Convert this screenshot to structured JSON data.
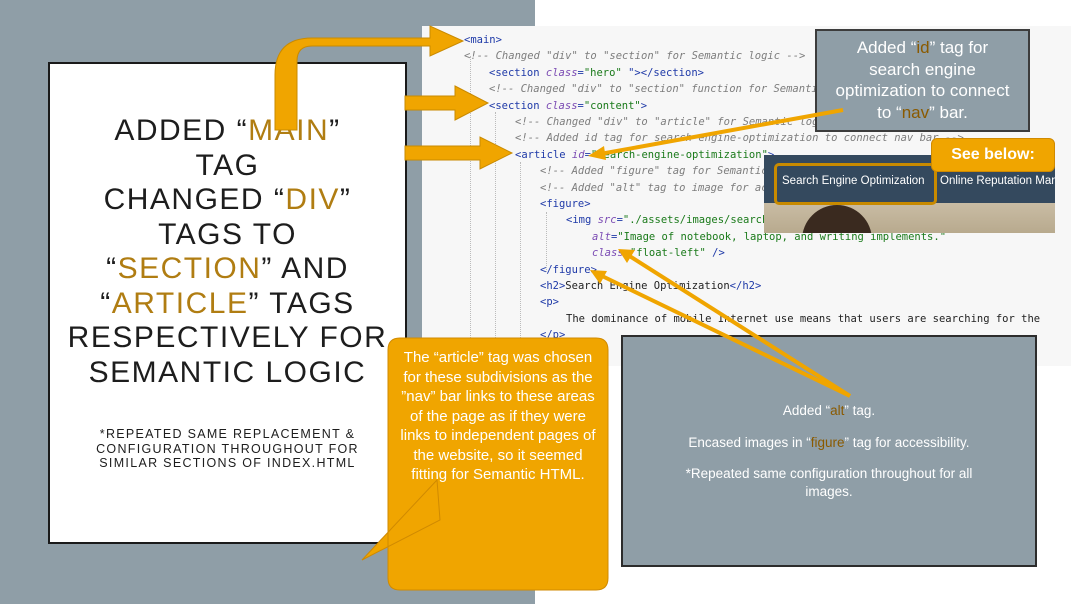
{
  "left_panel": {
    "title_lines": [
      {
        "pre": "ADDED “",
        "hl": "MAIN",
        "post": "”"
      },
      {
        "pre": "TAG",
        "hl": "",
        "post": ""
      },
      {
        "pre": "CHANGED “",
        "hl": "DIV",
        "post": "”"
      },
      {
        "pre": "TAGS TO",
        "hl": "",
        "post": ""
      },
      {
        "pre": "“",
        "hl": "SECTION",
        "post": "” AND"
      },
      {
        "pre": "“",
        "hl": "ARTICLE",
        "post": "” TAGS"
      },
      {
        "pre": "RESPECTIVELY FOR",
        "hl": "",
        "post": ""
      },
      {
        "pre": "SEMANTIC LOGIC",
        "hl": "",
        "post": ""
      }
    ],
    "note": "*REPEATED SAME REPLACEMENT & CONFIGURATION THROUGHOUT FOR SIMILAR SECTIONS OF INDEX.HTML"
  },
  "code": {
    "lines": [
      [
        {
          "c": "tag",
          "t": "<main>"
        }
      ],
      [
        {
          "c": "cmt",
          "t": "<!-- Changed \"div\" to \"section\" for Semantic logic --> "
        }
      ],
      [
        {
          "c": "tag",
          "t": "<section "
        },
        {
          "c": "attr",
          "t": "class"
        },
        {
          "c": "tag",
          "t": "="
        },
        {
          "c": "str",
          "t": "\"hero\""
        },
        {
          "c": "tag",
          "t": " \"></section>"
        }
      ],
      [
        {
          "c": "cmt",
          "t": "<!-- Changed \"div\" to \"section\" function for Semantic logic -->"
        }
      ],
      [
        {
          "c": "tag",
          "t": "<section "
        },
        {
          "c": "attr",
          "t": "class"
        },
        {
          "c": "tag",
          "t": "="
        },
        {
          "c": "str",
          "t": "\"content\""
        },
        {
          "c": "tag",
          "t": ">"
        }
      ],
      [
        {
          "c": "cmt",
          "t": "<!-- Changed \"div\" to \"article\" for Semantic logic -->"
        }
      ],
      [
        {
          "c": "cmt",
          "t": "<!-- Added id tag for search-engine-optimization to connect nav bar -->"
        }
      ],
      [
        {
          "c": "tag",
          "t": "<article "
        },
        {
          "c": "attr",
          "t": "id"
        },
        {
          "c": "tag",
          "t": "="
        },
        {
          "c": "str",
          "t": "\"search-engine-optimization\""
        },
        {
          "c": "tag",
          "t": ">"
        }
      ],
      [
        {
          "c": "cmt",
          "t": "<!-- Added \"figure\" tag for Semantic logic -->"
        }
      ],
      [
        {
          "c": "cmt",
          "t": "<!-- Added \"alt\" tag to image for accessibility -->"
        }
      ],
      [
        {
          "c": "tag",
          "t": "<figure>"
        }
      ],
      [
        {
          "c": "tag",
          "t": "<img "
        },
        {
          "c": "attr",
          "t": "src"
        },
        {
          "c": "tag",
          "t": "="
        },
        {
          "c": "str",
          "t": "\"./assets/images/search-engine-optimization.jpg\""
        }
      ],
      [
        {
          "c": "attr",
          "t": "alt"
        },
        {
          "c": "tag",
          "t": "="
        },
        {
          "c": "str",
          "t": "\"Image of notebook, laptop, and writing implements.\""
        }
      ],
      [
        {
          "c": "attr",
          "t": "class"
        },
        {
          "c": "tag",
          "t": "="
        },
        {
          "c": "str",
          "t": "\"float-left\""
        },
        {
          "c": "tag",
          "t": " />"
        }
      ],
      [
        {
          "c": "tag",
          "t": "</figure>"
        }
      ],
      [
        {
          "c": "tag",
          "t": "<h2>"
        },
        {
          "c": "txt",
          "t": "Search Engine Optimization"
        },
        {
          "c": "tag",
          "t": "</h2>"
        }
      ],
      [
        {
          "c": "tag",
          "t": "<p>"
        }
      ],
      [
        {
          "c": "txt",
          "t": "The dominance of mobile Internet use means that users are searching for the"
        }
      ],
      [
        {
          "c": "tag",
          "t": "</p>"
        }
      ]
    ]
  },
  "id_box": {
    "l1_pre": "Added “",
    "l1_hl": "id",
    "l1_post": "” tag for",
    "l2": "search engine",
    "l3": "optimization to connect",
    "l4_pre": "to “",
    "l4_hl": "nav",
    "l4_post": "” bar."
  },
  "see_below": "See below:",
  "nav": {
    "item1": "Search Engine Optimization",
    "item2": "Online Reputation Mar"
  },
  "alt_box": {
    "l1_pre": "Added “",
    "l1_hl": "alt",
    "l1_post": "” tag.",
    "l2_pre": "Encased images in “",
    "l2_hl": "figure",
    "l2_post": "” tag for accessibility.",
    "l3": "*Repeated same configuration throughout for all images."
  },
  "callout": "The “article” tag was chosen for these subdivisions as the ”nav” bar links to these areas of the page as if they were links to independent pages of the website, so it seemed fitting for Semantic HTML.",
  "colors": {
    "accent": "#f0a500",
    "accent_text": "#b07d12",
    "slate": "#8f9ea7",
    "nav_bar": "#34495e"
  }
}
